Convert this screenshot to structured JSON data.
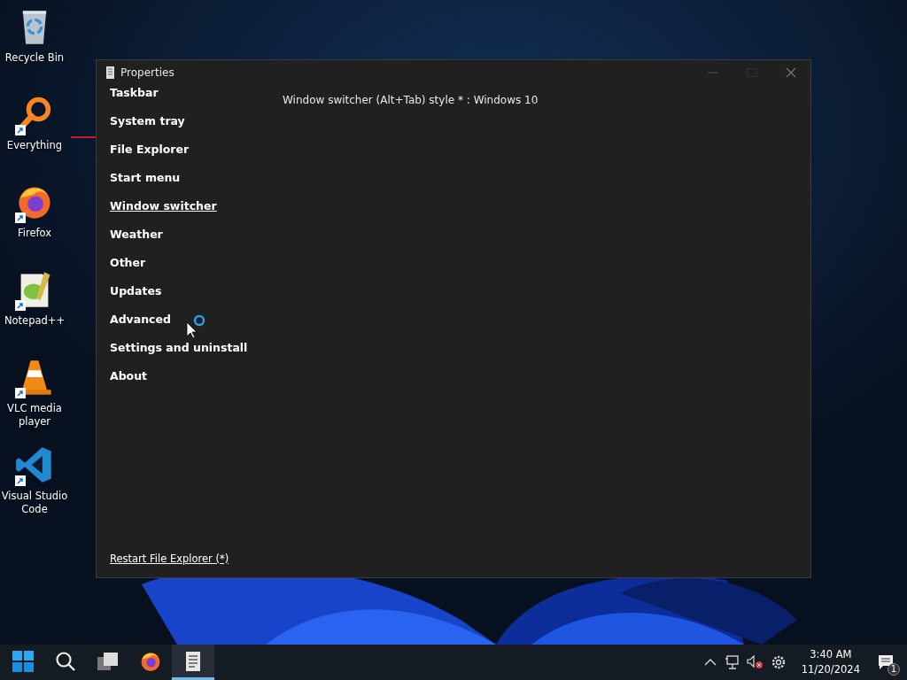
{
  "desktop_icons": [
    {
      "label": "Recycle Bin",
      "kind": "recycle",
      "shortcut": false
    },
    {
      "label": "Everything",
      "kind": "everything",
      "shortcut": true
    },
    {
      "label": "Firefox",
      "kind": "firefox",
      "shortcut": true
    },
    {
      "label": "Notepad++",
      "kind": "notepad",
      "shortcut": true
    },
    {
      "label": "VLC media player",
      "kind": "vlc",
      "shortcut": true
    },
    {
      "label": "Visual Studio Code",
      "kind": "vscode",
      "shortcut": true
    }
  ],
  "window": {
    "title": "Properties",
    "nav": [
      {
        "label": "Taskbar",
        "selected": false
      },
      {
        "label": "System tray",
        "selected": false
      },
      {
        "label": "File Explorer",
        "selected": false
      },
      {
        "label": "Start menu",
        "selected": false
      },
      {
        "label": "Window switcher",
        "selected": true
      },
      {
        "label": "Weather",
        "selected": false
      },
      {
        "label": "Other",
        "selected": false
      },
      {
        "label": "Updates",
        "selected": false
      },
      {
        "label": "Advanced",
        "selected": false
      },
      {
        "label": "Settings and uninstall",
        "selected": false
      },
      {
        "label": "About",
        "selected": false
      }
    ],
    "setting": "Window switcher (Alt+Tab) style * : Windows 10",
    "footer_link": "Restart File Explorer (*)"
  },
  "taskbar": {
    "apps": [
      {
        "kind": "start",
        "selected": false
      },
      {
        "kind": "search",
        "selected": false
      },
      {
        "kind": "taskview",
        "selected": false
      },
      {
        "kind": "firefox",
        "selected": false
      },
      {
        "kind": "properties",
        "selected": true
      }
    ],
    "time": "3:40 AM",
    "date": "11/20/2024",
    "notifications": "1"
  }
}
